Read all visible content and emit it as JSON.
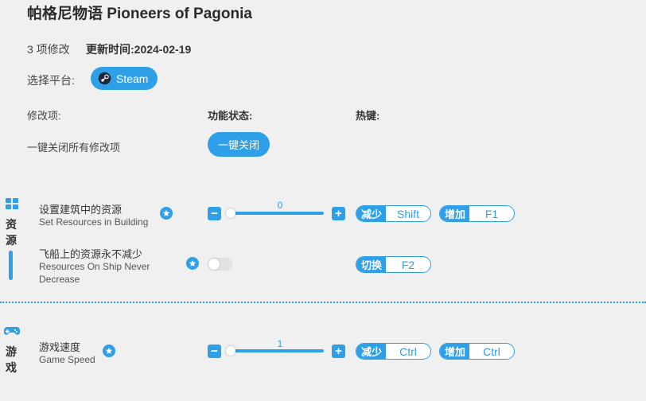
{
  "header": {
    "title": "帕格尼物语  Pioneers of Pagonia",
    "mod_count": "3 项修改",
    "updated": "更新时间:2024-02-19"
  },
  "platform": {
    "label": "选择平台:",
    "selected": "Steam"
  },
  "columns": {
    "mods": "修改项:",
    "state": "功能状态:",
    "hotkey": "热键:"
  },
  "close_all": {
    "label": "一键关闭所有修改项",
    "button": "一键关闭"
  },
  "accent": "#2f9fe8",
  "categories": [
    {
      "name_chars": [
        "资",
        "源"
      ],
      "icon": "grid-icon",
      "options": [
        {
          "cn": "设置建筑中的资源",
          "en": "Set Resources in Building",
          "control": "slider",
          "value": "0",
          "hotkeys": [
            {
              "action": "减少",
              "key": "Shift"
            },
            {
              "action": "增加",
              "key": "F1"
            }
          ]
        },
        {
          "cn": "飞船上的资源永不减少",
          "en_line1": "Resources On Ship Never",
          "en_line2": "Decrease",
          "control": "toggle",
          "enabled": false,
          "hotkeys": [
            {
              "action": "切换",
              "key": "F2"
            }
          ]
        }
      ]
    },
    {
      "name_chars": [
        "游",
        "戏"
      ],
      "icon": "gamepad-icon",
      "options": [
        {
          "cn": "游戏速度",
          "en": "Game Speed",
          "control": "slider",
          "value": "1",
          "hotkeys": [
            {
              "action": "减少",
              "key": "Ctrl"
            },
            {
              "action": "增加",
              "key": "Ctrl"
            }
          ]
        }
      ]
    }
  ]
}
